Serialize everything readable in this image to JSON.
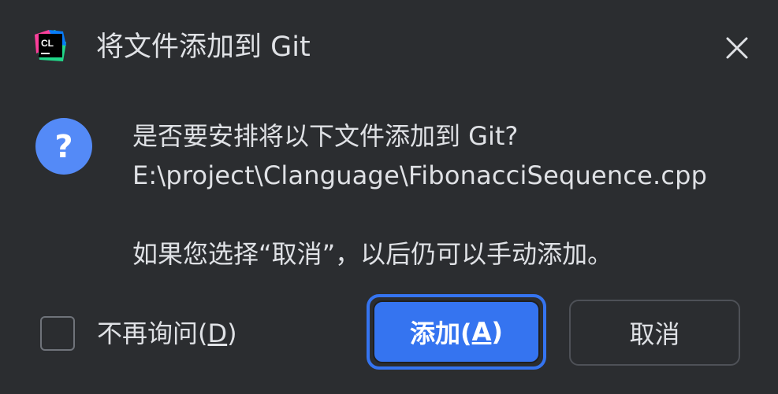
{
  "dialog": {
    "title": "将文件添加到 Git",
    "app_icon_text": "CL",
    "message": {
      "question": "是否要安排将以下文件添加到 Git?",
      "file_path": "E:\\project\\Clanguage\\FibonacciSequence.cpp",
      "hint": "如果您选择“取消”，以后仍可以手动添加。"
    },
    "checkbox": {
      "label_prefix": "不再询问(",
      "label_mnemonic": "D",
      "label_suffix": ")",
      "checked": false
    },
    "buttons": {
      "add_prefix": "添加(",
      "add_mnemonic": "A",
      "add_suffix": ")",
      "cancel": "取消"
    }
  },
  "colors": {
    "background": "#2b2d30",
    "text": "#dfe1e5",
    "accent": "#3574f0",
    "question_icon": "#548af7"
  },
  "icons": {
    "app": "clion-logo-icon",
    "close": "close-icon",
    "question": "question-icon"
  }
}
